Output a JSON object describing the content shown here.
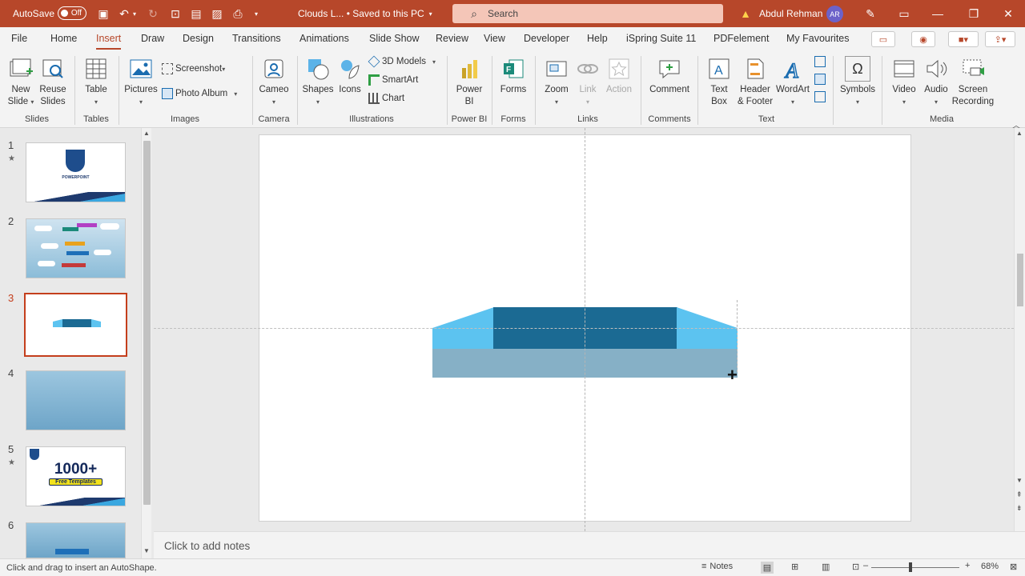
{
  "titlebar": {
    "autosave_label": "AutoSave",
    "autosave_state": "Off",
    "doc_title": "Clouds L...  •  Saved to this PC",
    "search_placeholder": "Search",
    "user_name": "Abdul Rehman",
    "user_initials": "AR"
  },
  "tabs": [
    "File",
    "Home",
    "Insert",
    "Draw",
    "Design",
    "Transitions",
    "Animations",
    "Slide Show",
    "Review",
    "View",
    "Developer",
    "Help",
    "iSpring Suite 11",
    "PDFelement",
    "My Favourites"
  ],
  "active_tab": "Insert",
  "ribbon": {
    "groups": {
      "slides": "Slides",
      "tables": "Tables",
      "images": "Images",
      "camera": "Camera",
      "illustrations": "Illustrations",
      "powerbi": "Power BI",
      "forms": "Forms",
      "links": "Links",
      "comments": "Comments",
      "text": "Text",
      "media": "Media"
    },
    "buttons": {
      "new_slide_1": "New",
      "new_slide_2": "Slide",
      "reuse_1": "Reuse",
      "reuse_2": "Slides",
      "table": "Table",
      "pictures": "Pictures",
      "screenshot": "Screenshot",
      "photo_album": "Photo Album",
      "cameo": "Cameo",
      "shapes": "Shapes",
      "icons": "Icons",
      "models_3d": "3D Models",
      "smartart": "SmartArt",
      "chart": "Chart",
      "powerbi_1": "Power",
      "powerbi_2": "BI",
      "forms": "Forms",
      "zoom": "Zoom",
      "link": "Link",
      "action": "Action",
      "comment": "Comment",
      "textbox_1": "Text",
      "textbox_2": "Box",
      "header_1": "Header",
      "header_2": "& Footer",
      "wordart": "WordArt",
      "symbols": "Symbols",
      "video": "Video",
      "audio": "Audio",
      "screen_rec_1": "Screen",
      "screen_rec_2": "Recording"
    }
  },
  "slides_panel": {
    "numbers": [
      "1",
      "2",
      "3",
      "4",
      "5",
      "6"
    ],
    "selected": "3",
    "thumb1_title": "POWERPOINT",
    "thumb5_big": "1000+",
    "thumb5_sub": "Free Templates"
  },
  "notes_placeholder": "Click to add notes",
  "status": {
    "hint": "Click and drag to insert an AutoShape.",
    "notes": "Notes",
    "zoom": "68%"
  },
  "colors": {
    "accent": "#b7472a",
    "shape_dark": "#1b6a93",
    "shape_light": "#5cc3f0",
    "shape_base": "#7aa6bd"
  }
}
